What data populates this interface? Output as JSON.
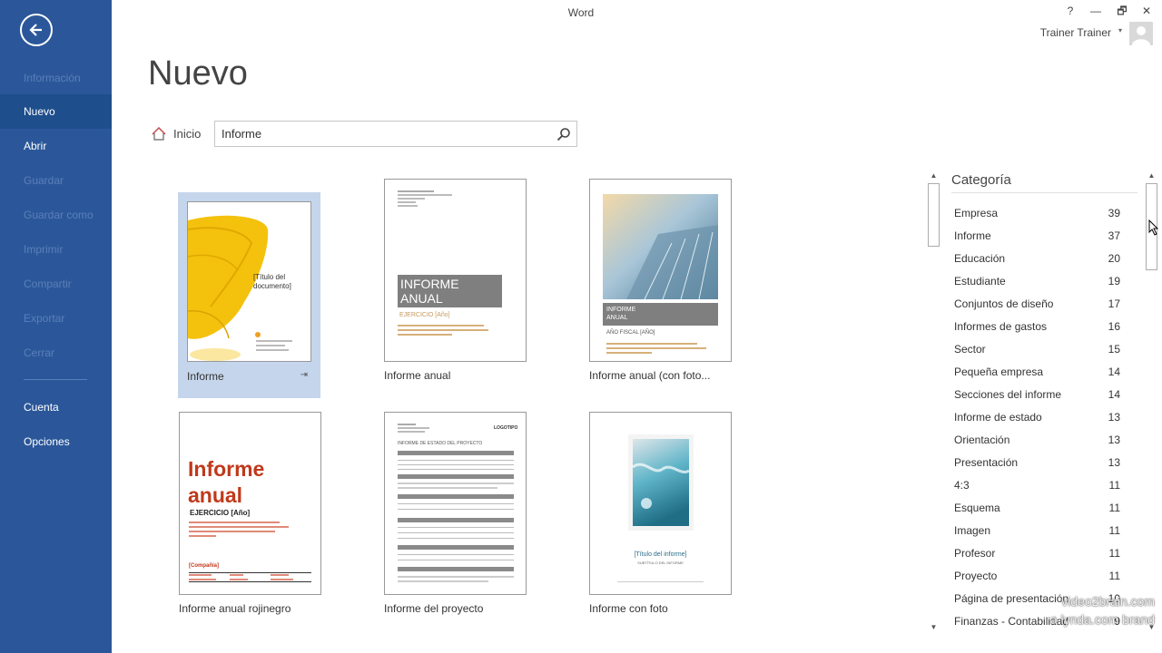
{
  "app": {
    "title": "Word"
  },
  "window_controls": {
    "help": "?",
    "minimize": "—",
    "restore": "🗗",
    "close": "✕"
  },
  "user": {
    "name": "Trainer Trainer",
    "caret": "▾"
  },
  "sidebar": {
    "items": [
      {
        "label": "Información",
        "state": "disabled"
      },
      {
        "label": "Nuevo",
        "state": "selected"
      },
      {
        "label": "Abrir",
        "state": "normal"
      },
      {
        "label": "Guardar",
        "state": "disabled"
      },
      {
        "label": "Guardar como",
        "state": "disabled"
      },
      {
        "label": "Imprimir",
        "state": "disabled"
      },
      {
        "label": "Compartir",
        "state": "disabled"
      },
      {
        "label": "Exportar",
        "state": "disabled"
      },
      {
        "label": "Cerrar",
        "state": "disabled"
      },
      {
        "label": "Cuenta",
        "state": "normal"
      },
      {
        "label": "Opciones",
        "state": "normal"
      }
    ]
  },
  "page": {
    "heading": "Nuevo",
    "home_label": "Inicio"
  },
  "search": {
    "value": "Informe",
    "placeholder": ""
  },
  "templates": [
    {
      "label": "Informe",
      "selected": true,
      "thumb_title": "[Título del documento]"
    },
    {
      "label": "Informe anual",
      "thumb_title": "INFORME ANUAL",
      "thumb_sub": "EJERCICIO [Año]"
    },
    {
      "label": "Informe anual (con foto...",
      "thumb_title": "INFORME ANUAL",
      "thumb_sub": "AÑO FISCAL [AÑO]"
    },
    {
      "label": "Informe anual rojinegro",
      "thumb_title": "Informe anual",
      "thumb_sub": "EJERCICIO [Año]",
      "thumb_footer": "[Compañía]"
    },
    {
      "label": "Informe del proyecto",
      "thumb_title": "INFORME DE ESTADO DEL PROYECTO",
      "thumb_logo": "LOGOTIPO"
    },
    {
      "label": "Informe con foto",
      "thumb_title": "[Título del informe]",
      "thumb_sub": "SUBTÍTULO DEL INFORME"
    }
  ],
  "categories": {
    "heading": "Categoría",
    "items": [
      {
        "name": "Empresa",
        "count": "39"
      },
      {
        "name": "Informe",
        "count": "37"
      },
      {
        "name": "Educación",
        "count": "20"
      },
      {
        "name": "Estudiante",
        "count": "19"
      },
      {
        "name": "Conjuntos de diseño",
        "count": "17"
      },
      {
        "name": "Informes de gastos",
        "count": "16"
      },
      {
        "name": "Sector",
        "count": "15"
      },
      {
        "name": "Pequeña empresa",
        "count": "14"
      },
      {
        "name": "Secciones del informe",
        "count": "14"
      },
      {
        "name": "Informe de estado",
        "count": "13"
      },
      {
        "name": "Orientación",
        "count": "13"
      },
      {
        "name": "Presentación",
        "count": "13"
      },
      {
        "name": "4:3",
        "count": "11"
      },
      {
        "name": "Esquema",
        "count": "11"
      },
      {
        "name": "Imagen",
        "count": "11"
      },
      {
        "name": "Profesor",
        "count": "11"
      },
      {
        "name": "Proyecto",
        "count": "11"
      },
      {
        "name": "Página de presentación",
        "count": "10"
      },
      {
        "name": "Finanzas - Contabilidad",
        "count": "9"
      }
    ]
  },
  "watermark": {
    "line1": "video2brain.com",
    "line2": "a lynda.com brand"
  },
  "colors": {
    "sidebar": "#2b579a",
    "sidebar_selected": "#1e4e8c",
    "selection": "#c5d5ec",
    "butterfly": "#f4c20d",
    "red_title": "#c0391b"
  }
}
